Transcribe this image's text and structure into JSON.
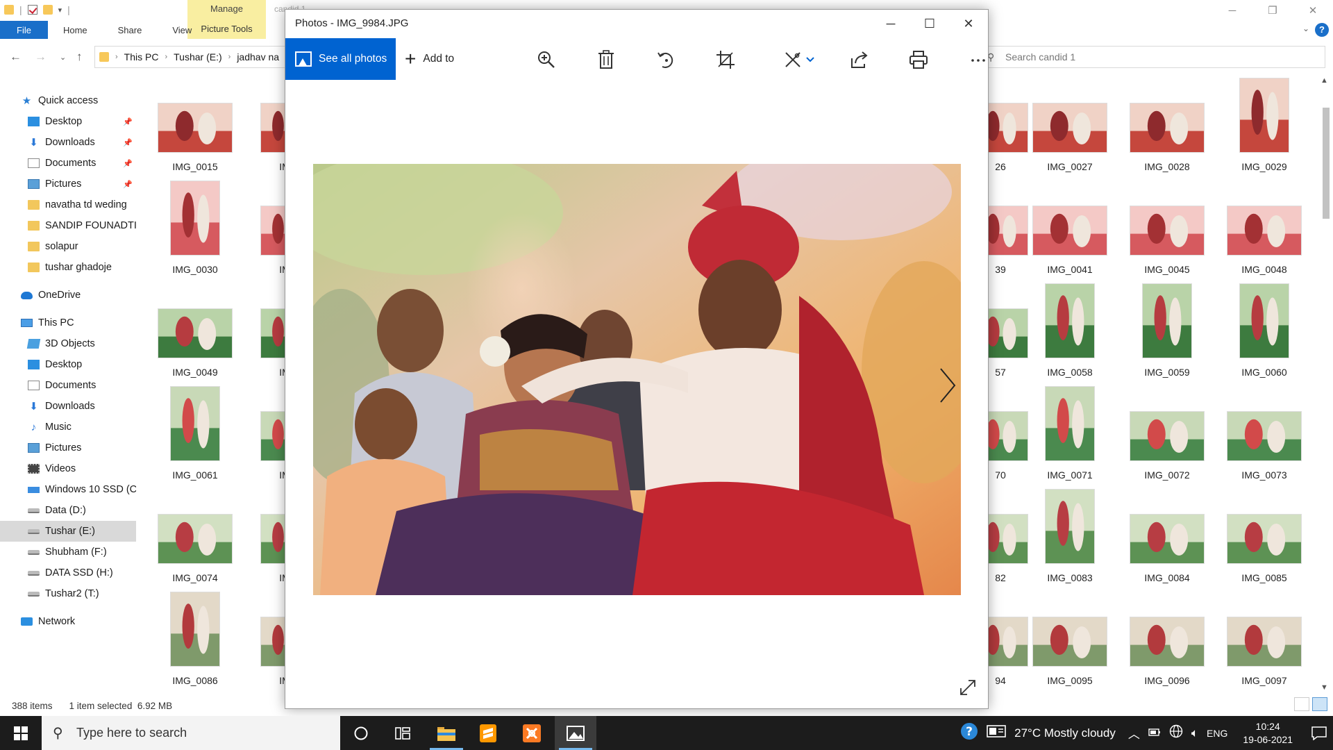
{
  "explorer": {
    "ribbon": {
      "manage_label": "Manage",
      "picture_tools_label": "Picture Tools",
      "tabs": [
        "File",
        "Home",
        "Share",
        "View"
      ],
      "window_title_fragment": "candid 1"
    },
    "breadcrumb": [
      "This PC",
      "Tushar (E:)",
      "jadhav na"
    ],
    "search_placeholder": "Search candid 1",
    "nav": {
      "quick_access": "Quick access",
      "quick_items": [
        "Desktop",
        "Downloads",
        "Documents",
        "Pictures",
        "navatha td weding",
        "SANDIP FOUNADTI(",
        "solapur",
        "tushar ghadoje"
      ],
      "onedrive": "OneDrive",
      "this_pc": "This PC",
      "pc_items": [
        "3D Objects",
        "Desktop",
        "Documents",
        "Downloads",
        "Music",
        "Pictures",
        "Videos",
        "Windows 10 SSD (C",
        "Data (D:)",
        "Tushar (E:)",
        "Shubham (F:)",
        "DATA SSD (H:)",
        "Tushar2 (T:)"
      ],
      "network": "Network"
    },
    "thumbnails_left": [
      "IMG_0015",
      "IMG_0030",
      "IMG_0049",
      "IMG_0061",
      "IMG_0074",
      "IMG_0086"
    ],
    "thumbnails_left_partial": [
      "IM",
      "IM",
      "IM",
      "IM",
      "IM",
      "IM"
    ],
    "thumbnails_right_partial": [
      "26",
      "39",
      "57",
      "70",
      "82",
      "94"
    ],
    "thumbnails_right": [
      [
        "IMG_0027",
        "IMG_0028",
        "IMG_0029"
      ],
      [
        "IMG_0041",
        "IMG_0045",
        "IMG_0048"
      ],
      [
        "IMG_0058",
        "IMG_0059",
        "IMG_0060"
      ],
      [
        "IMG_0071",
        "IMG_0072",
        "IMG_0073"
      ],
      [
        "IMG_0083",
        "IMG_0084",
        "IMG_0085"
      ],
      [
        "IMG_0095",
        "IMG_0096",
        "IMG_0097"
      ]
    ],
    "status": {
      "item_count": "388 items",
      "selection": "1 item selected",
      "size": "6.92 MB"
    }
  },
  "photos": {
    "title": "Photos - IMG_9984.JPG",
    "see_all_label": "See all photos",
    "add_to_label": "Add to",
    "toolbar_icons": [
      "zoom-in-icon",
      "delete-icon",
      "rotate-icon",
      "crop-icon",
      "edit-icon",
      "share-icon",
      "print-icon",
      "more-icon"
    ]
  },
  "taskbar": {
    "search_placeholder": "Type here to search",
    "weather": "27°C  Mostly cloudy",
    "language": "ENG",
    "time": "10:24",
    "date": "19-06-2021"
  }
}
